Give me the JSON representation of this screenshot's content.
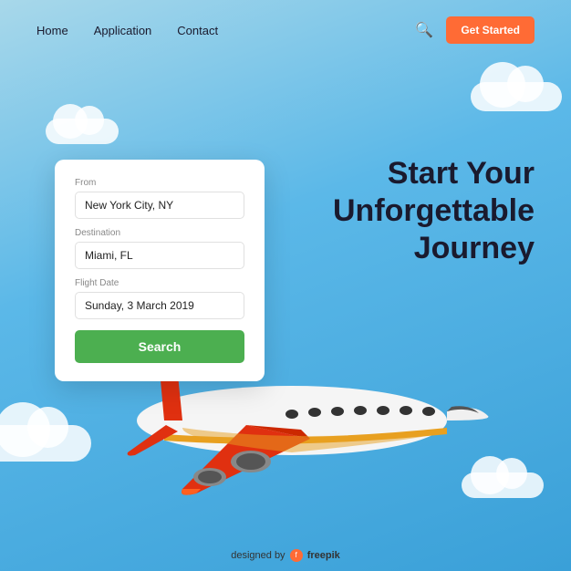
{
  "navbar": {
    "links": [
      {
        "label": "Home",
        "id": "home"
      },
      {
        "label": "Application",
        "id": "application"
      },
      {
        "label": "Contact",
        "id": "contact"
      }
    ],
    "cta_label": "Get Started"
  },
  "hero": {
    "title_line1": "Start Your",
    "title_line2": "Unforgettable",
    "title_line3": "Journey"
  },
  "search_form": {
    "from_label": "From",
    "from_value": "New York City, NY",
    "destination_label": "Destination",
    "destination_value": "Miami, FL",
    "date_label": "Flight Date",
    "date_value": "Sunday, 3 March 2019",
    "search_button": "Search"
  },
  "footer": {
    "text": "designed by",
    "brand": "freepik"
  }
}
